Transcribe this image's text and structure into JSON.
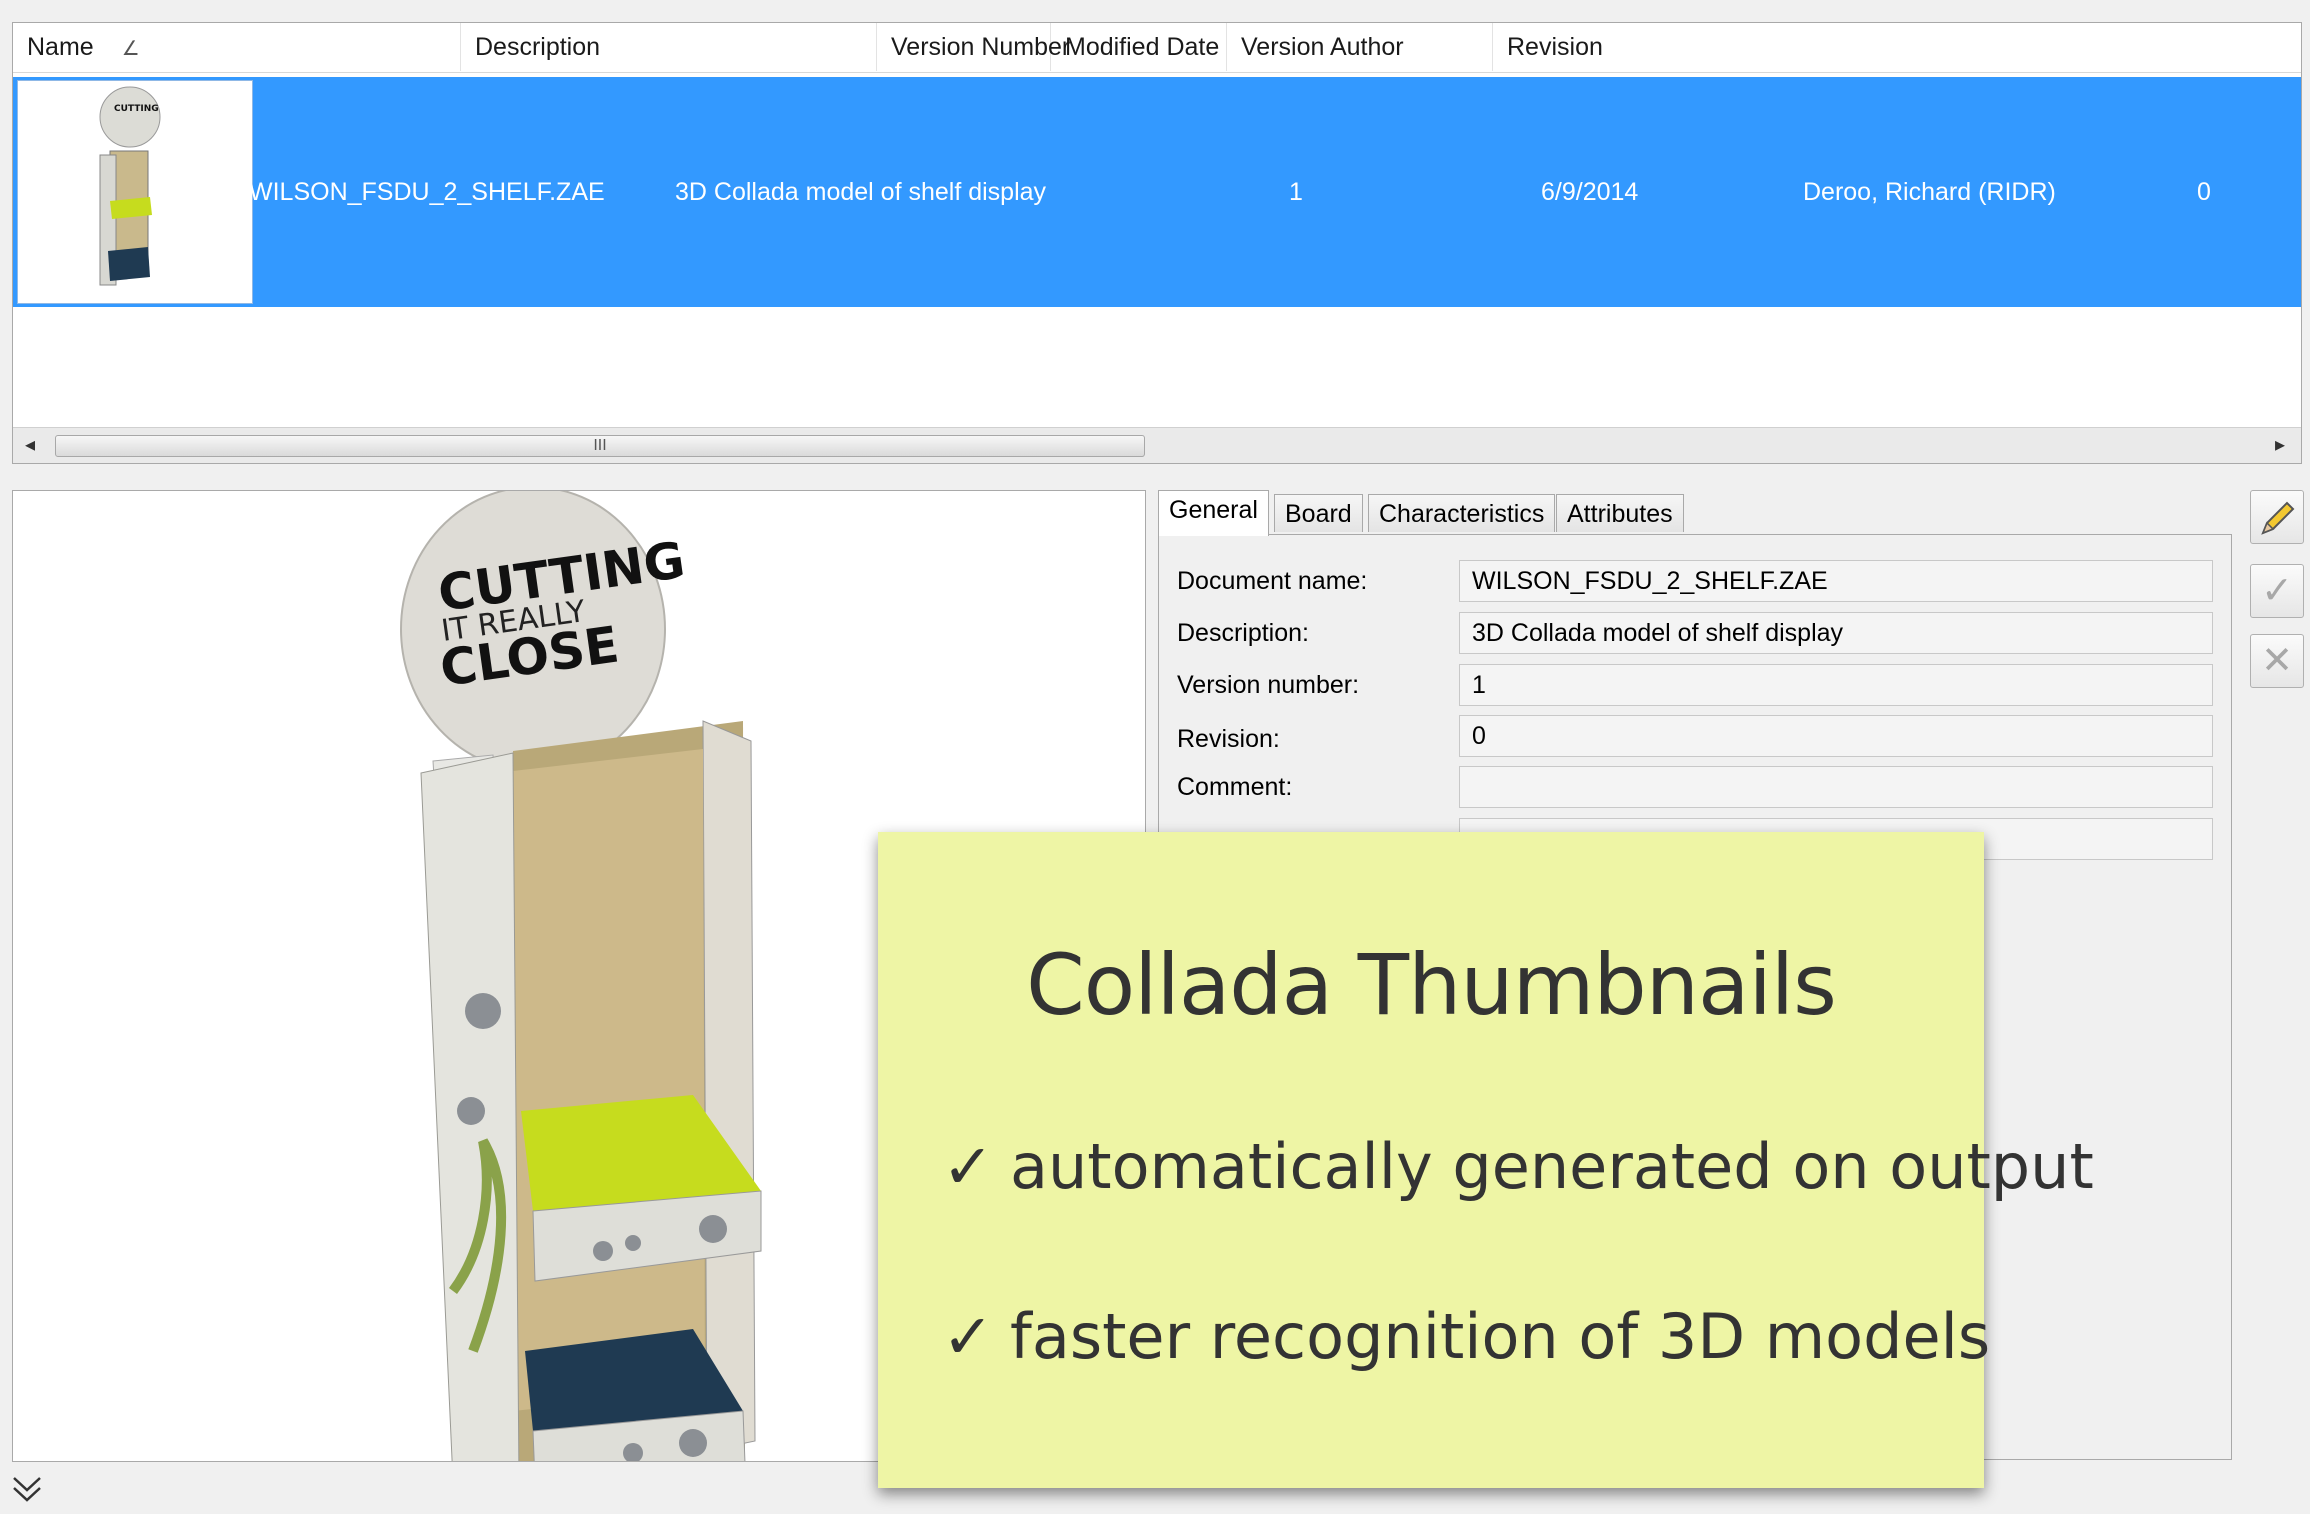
{
  "grid": {
    "columns": [
      {
        "label": "Name",
        "sort_icon": "sort-indicator-icon"
      },
      {
        "label": "Description"
      },
      {
        "label": "Version Number"
      },
      {
        "label": "Modified Date"
      },
      {
        "label": "Version Author"
      },
      {
        "label": "Revision"
      }
    ],
    "rows": [
      {
        "name": "WILSON_FSDU_2_SHELF.ZAE",
        "description": "3D Collada model of shelf display",
        "version_number": "1",
        "modified_date": "6/9/2014",
        "version_author": "Deroo, Richard (RIDR)",
        "revision": "0",
        "selected": true
      }
    ],
    "scroll_grip": "III"
  },
  "preview": {
    "model_text": {
      "line1": "CUTTING",
      "line2": "IT REALLY",
      "line3": "CLOSE"
    }
  },
  "properties": {
    "tabs": [
      {
        "label": "General",
        "active": true
      },
      {
        "label": "Board"
      },
      {
        "label": "Characteristics"
      },
      {
        "label": "Attributes"
      }
    ],
    "fields": [
      {
        "label": "Document name:",
        "value": "WILSON_FSDU_2_SHELF.ZAE"
      },
      {
        "label": "Description:",
        "value": "3D Collada model of shelf display"
      },
      {
        "label": "Version number:",
        "value": "1"
      },
      {
        "label": "Revision:",
        "value": "0"
      },
      {
        "label": "Comment:",
        "value": ""
      }
    ]
  },
  "toolbar": {
    "edit_icon": "pencil-icon",
    "apply_icon": "checkmark-icon",
    "cancel_icon": "close-icon"
  },
  "overlay": {
    "title": "Collada Thumbnails",
    "items": [
      "automatically generated on output",
      "faster recognition of 3D models"
    ],
    "check_glyph": "✓"
  },
  "colors": {
    "selection": "#3399ff",
    "overlay_bg": "#eef5a5",
    "model_accent": "#c6dc1e",
    "model_dark": "#1f3a52"
  }
}
